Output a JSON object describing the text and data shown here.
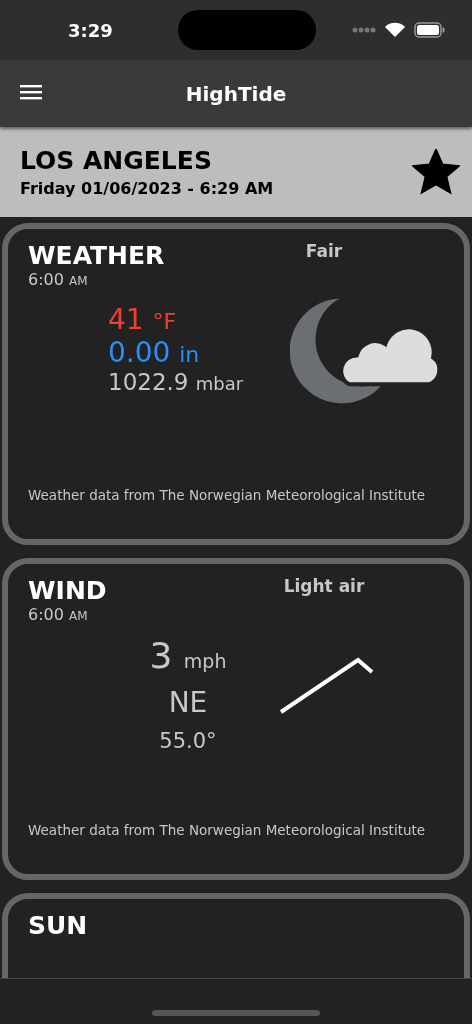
{
  "status_bar": {
    "time": "3:29"
  },
  "nav_bar": {
    "title": "HighTide"
  },
  "location": {
    "name": "LOS ANGELES",
    "datetime": "Friday 01/06/2023 - 6:29 AM",
    "favorite": true
  },
  "cards": [
    {
      "kind": "weather",
      "title": "WEATHER",
      "time": "6:00",
      "period": "AM",
      "condition": "Fair",
      "readings": [
        {
          "value": "41",
          "unit": "°F",
          "color": "#ec4034"
        },
        {
          "value": "0.00",
          "unit": "in",
          "color": "#2a8ef2"
        },
        {
          "value": "1022.9",
          "unit": "mbar",
          "color": "#c8c8c8"
        }
      ],
      "credit": "Weather data from The Norwegian Meteorological Institute"
    },
    {
      "kind": "wind",
      "title": "WIND",
      "time": "6:00",
      "period": "AM",
      "condition": "Light air",
      "speed": "3",
      "speed_unit": "mph",
      "direction": "NE",
      "degrees": "55.0°",
      "credit": "Weather data from The Norwegian Meteorological Institute"
    },
    {
      "kind": "sun",
      "title": "SUN"
    }
  ]
}
